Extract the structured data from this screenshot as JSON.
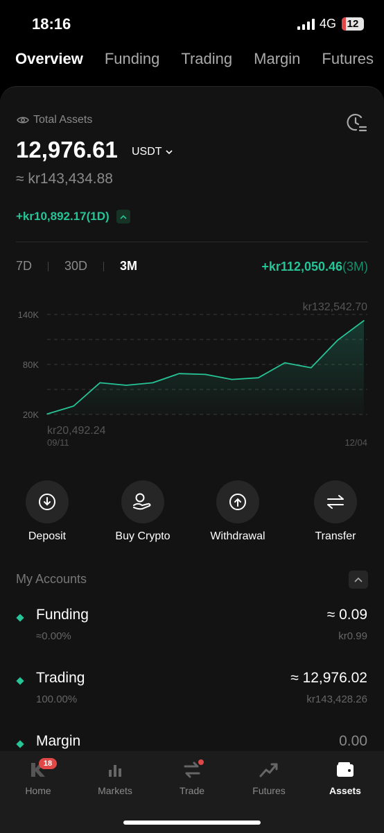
{
  "status": {
    "time": "18:16",
    "network": "4G",
    "battery": "12"
  },
  "tabs": [
    "Overview",
    "Funding",
    "Trading",
    "Margin",
    "Futures"
  ],
  "summary": {
    "label": "Total Assets",
    "value": "12,976.61",
    "currency": "USDT",
    "approx": "≈ kr143,434.88",
    "pnl": "+kr10,892.17(1D)"
  },
  "range": {
    "options": [
      "7D",
      "30D",
      "3M"
    ],
    "selected": "3M",
    "change": "+kr112,050.46",
    "change_period": "(3M)"
  },
  "chart_data": {
    "type": "area",
    "x": [
      "09/11",
      "",
      "",
      "",
      "",
      "",
      "",
      "",
      "",
      "",
      "",
      "",
      "",
      "12/04"
    ],
    "values": [
      20492.24,
      30000,
      58000,
      55000,
      58000,
      69000,
      68000,
      62000,
      64000,
      82000,
      76000,
      109000,
      132542.7
    ],
    "ylim": [
      20000,
      140000
    ],
    "yticks": [
      "140K",
      "80K",
      "20K"
    ],
    "xlabels": [
      "09/11",
      "12/04"
    ],
    "max_label": "kr132,542.70",
    "min_label": "kr20,492.24",
    "color": "#26c496"
  },
  "actions": [
    {
      "label": "Deposit",
      "icon": "deposit-icon"
    },
    {
      "label": "Buy Crypto",
      "icon": "buy-crypto-icon"
    },
    {
      "label": "Withdrawal",
      "icon": "withdrawal-icon"
    },
    {
      "label": "Transfer",
      "icon": "transfer-icon"
    }
  ],
  "accounts": {
    "title": "My Accounts",
    "items": [
      {
        "name": "Funding",
        "pct": "≈0.00%",
        "value": "≈ 0.09",
        "fiat": "kr0.99"
      },
      {
        "name": "Trading",
        "pct": "100.00%",
        "value": "≈ 12,976.02",
        "fiat": "kr143,428.26"
      },
      {
        "name": "Margin",
        "pct": "",
        "value": "0.00",
        "fiat": ""
      }
    ]
  },
  "nav": [
    {
      "label": "Home",
      "badge": "18"
    },
    {
      "label": "Markets"
    },
    {
      "label": "Trade"
    },
    {
      "label": "Futures"
    },
    {
      "label": "Assets"
    }
  ],
  "colors": {
    "accent": "#26c496",
    "badge": "#e04848"
  }
}
